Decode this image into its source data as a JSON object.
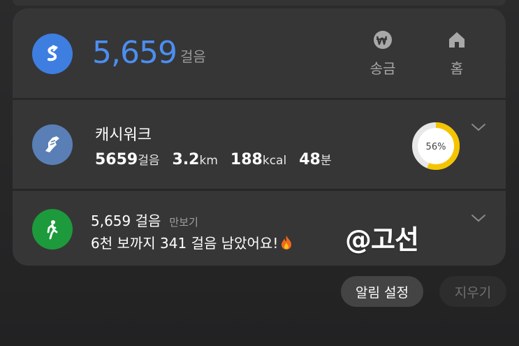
{
  "steps_card": {
    "count": "5,659",
    "unit": "걸음",
    "send_money_label": "송금",
    "home_label": "홈",
    "app_icon": "samsung-health-icon"
  },
  "cashwalk_card": {
    "title": "캐시워크",
    "steps_value": "5659",
    "steps_unit": "걸음",
    "distance_value": "3.2",
    "distance_unit": "km",
    "calories_value": "188",
    "calories_unit": "kcal",
    "minutes_value": "48",
    "minutes_unit": "분",
    "progress_label": "56%",
    "progress": 0.56,
    "colors": {
      "ring": "#f5c400",
      "track": "#e8e8e8"
    }
  },
  "pedometer_card": {
    "steps": "5,659 걸음",
    "app_name": "만보기",
    "message": "6천 보까지 341 걸음 남았어요!"
  },
  "watermark": "@고선",
  "actions": {
    "settings_label": "알림 설정",
    "clear_label": "지우기"
  },
  "colors": {
    "accent_blue": "#4b8ff0",
    "pedometer_green": "#1d9a3c",
    "cashwalk_blue": "#5a7fb6"
  }
}
